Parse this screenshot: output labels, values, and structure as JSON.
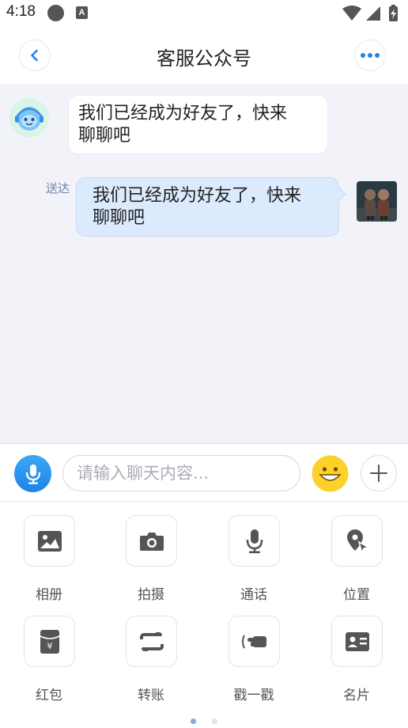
{
  "status_bar": {
    "time": "4:18",
    "badge_letter": "A"
  },
  "header": {
    "title": "客服公众号"
  },
  "chat": {
    "messages": [
      {
        "side": "left",
        "text_line1": "我们已经成为好友了，快来",
        "text_line2": "聊聊吧"
      },
      {
        "side": "right",
        "status": "送达",
        "text_line1": "我们已经成为好友了，快来",
        "text_line2": "聊聊吧"
      }
    ]
  },
  "input_bar": {
    "placeholder": "请输入聊天内容..."
  },
  "panel": {
    "tools": [
      {
        "label": "相册",
        "icon": "photo-album-icon"
      },
      {
        "label": "拍摄",
        "icon": "camera-icon"
      },
      {
        "label": "通话",
        "icon": "microphone-icon"
      },
      {
        "label": "位置",
        "icon": "location-icon"
      },
      {
        "label": "红包",
        "icon": "red-packet-icon"
      },
      {
        "label": "转账",
        "icon": "transfer-icon"
      },
      {
        "label": "戳一戳",
        "icon": "poke-icon"
      },
      {
        "label": "名片",
        "icon": "business-card-icon"
      }
    ],
    "pages": 2,
    "active_page": 1
  },
  "colors": {
    "accent": "#1f84e8",
    "outgoing_bubble": "#dbeafd",
    "icon_gray": "#555555"
  }
}
